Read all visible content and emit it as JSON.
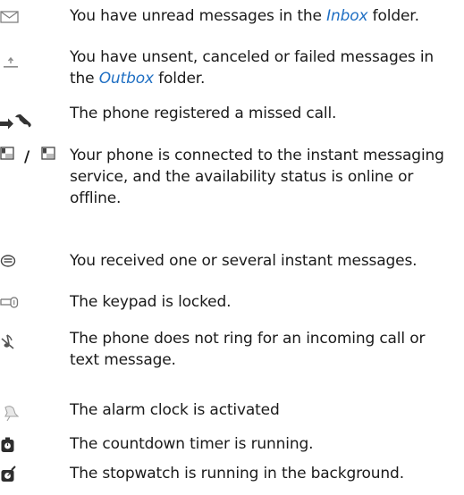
{
  "indicators": [
    {
      "icon": "envelope-icon",
      "text_before": "You have unread messages in the ",
      "folder": "Inbox",
      "text_after": " folder."
    },
    {
      "icon": "outbox-upload-icon",
      "text_before": "You have unsent, canceled or failed messages in the ",
      "folder": "Outbox",
      "text_after": " folder."
    },
    {
      "icon": "missed-call-icon",
      "text": "The phone registered a missed call."
    },
    {
      "icon": "instant-messaging-status-icon",
      "separator": "/",
      "text": "Your phone is connected to the instant messaging service, and the availability status is online or offline."
    },
    {
      "icon": "instant-message-icon",
      "text": "You received one or several instant messages."
    },
    {
      "icon": "key-lock-icon",
      "text": "The keypad is locked."
    },
    {
      "icon": "silent-ringer-icon",
      "text": "The phone does not ring for an incoming call or text message."
    },
    {
      "icon": "alarm-clock-icon",
      "text": "The alarm clock is activated"
    },
    {
      "icon": "countdown-timer-icon",
      "text": "The countdown timer is running."
    },
    {
      "icon": "stopwatch-icon",
      "text": "The stopwatch is running in the background."
    }
  ]
}
